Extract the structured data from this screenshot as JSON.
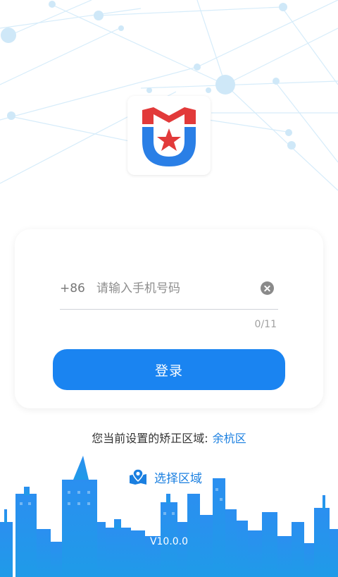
{
  "app": {
    "logo_icon": "shield-star-logo"
  },
  "login": {
    "country_code": "+86",
    "phone_placeholder": "请输入手机号码",
    "phone_value": "",
    "char_counter": "0/11",
    "login_label": "登录"
  },
  "region": {
    "prefix": "您当前设置的矫正区域:",
    "current": "余杭区",
    "select_label": "选择区域"
  },
  "footer": {
    "version": "V10.0.0"
  },
  "colors": {
    "primary": "#1a84f1",
    "link": "#1a7fe0",
    "logo_red": "#e23a3a",
    "logo_blue": "#2a7fe6"
  }
}
